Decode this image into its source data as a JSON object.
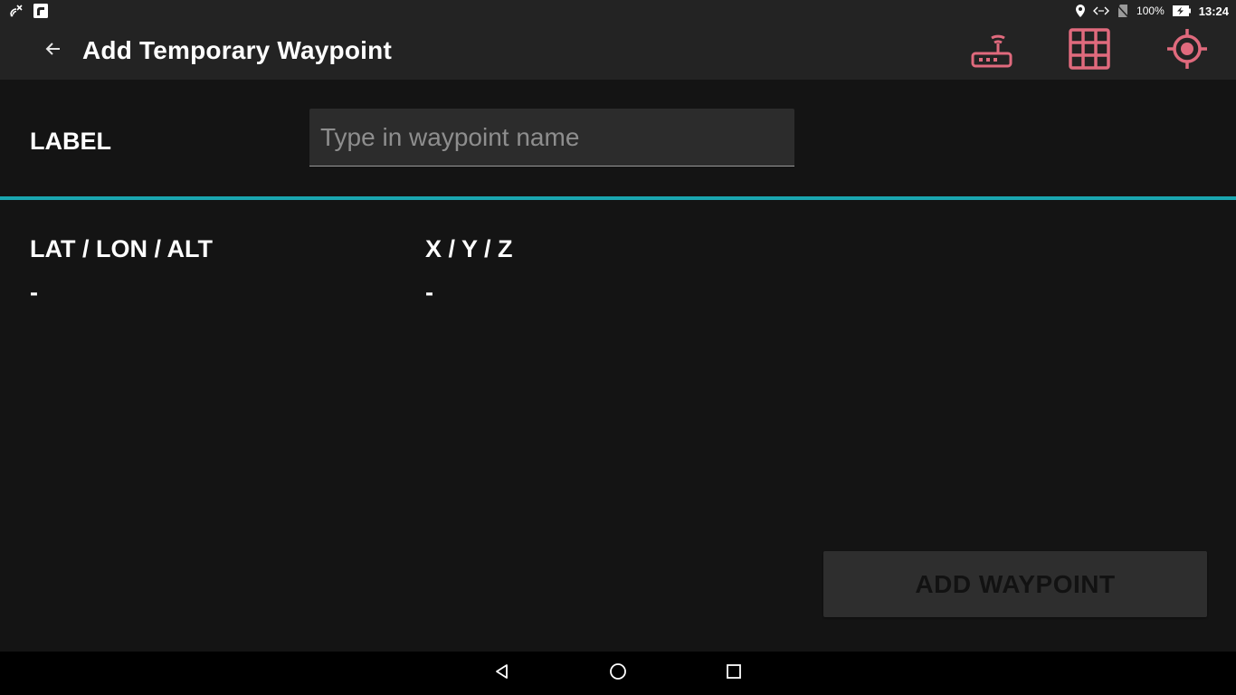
{
  "status_bar": {
    "battery_text": "100%",
    "time": "13:24",
    "left_icons": [
      "no-gps-signal-icon",
      "notification-app-icon"
    ],
    "right_icons": [
      "location-pin-icon",
      "data-transfer-icon",
      "no-sim-icon",
      "battery-charging-icon"
    ]
  },
  "app_bar": {
    "title": "Add Temporary Waypoint",
    "back_icon": "arrow-left-icon",
    "actions": [
      "router-icon",
      "grid-icon",
      "crosshair-target-icon"
    ]
  },
  "form": {
    "label_heading": "LABEL",
    "label_value": "",
    "label_placeholder": "Type in waypoint name"
  },
  "coordinates": {
    "lla_heading": "LAT / LON / ALT",
    "lla_value": "-",
    "xyz_heading": "X / Y / Z",
    "xyz_value": "-"
  },
  "add_button": {
    "label": "ADD WAYPOINT",
    "enabled": false
  },
  "nav_bar": {
    "icons": [
      "nav-back-icon",
      "nav-home-icon",
      "nav-recent-apps-icon"
    ]
  },
  "colors": {
    "background": "#141414",
    "app_bar": "#232323",
    "accent_pink": "#e06a7d",
    "divider_teal": "#1aa6b0",
    "input_bg": "#2c2c2c",
    "button_disabled_bg": "#2e2e2e"
  }
}
